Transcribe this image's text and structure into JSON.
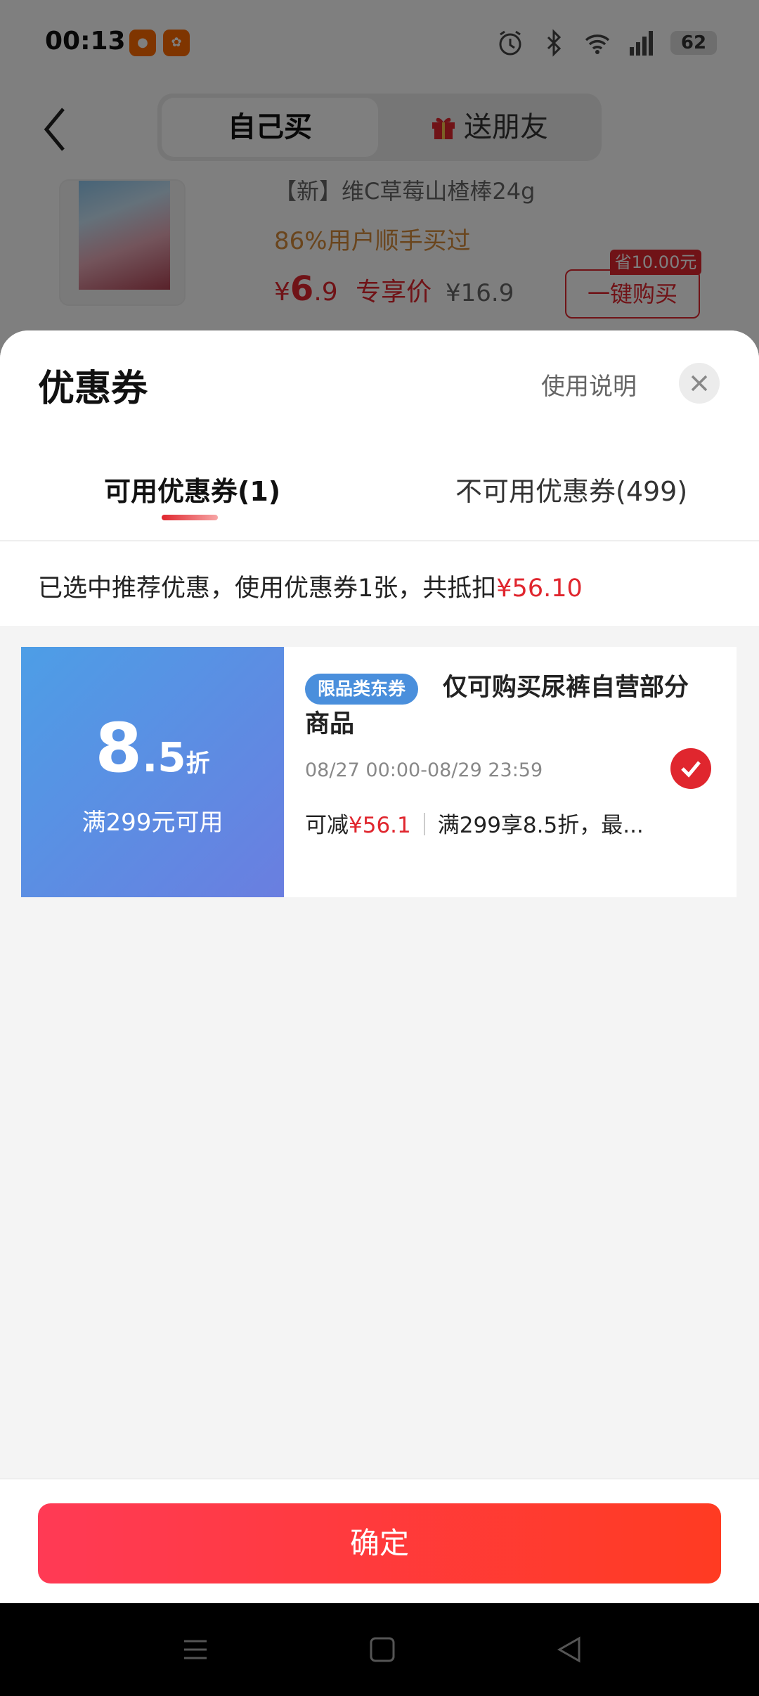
{
  "status_bar": {
    "time": "00:13",
    "battery": "62"
  },
  "nav": {
    "tab_self": "自己买",
    "tab_gift": "送朋友"
  },
  "product": {
    "title": "【新】维C草莓山楂棒24g",
    "subtitle": "86%用户顺手买过",
    "price_symbol": "¥",
    "price_int": "6",
    "price_dec": ".9",
    "price_label": "专享价",
    "original_price": "¥16.9",
    "buy_button": "一键购买",
    "save_tag": "省10.00元"
  },
  "sheet": {
    "title": "优惠券",
    "usage_link": "使用说明",
    "tab_available": "可用优惠券(1)",
    "tab_unavailable": "不可用优惠券(499)",
    "summary_text": "已选中推荐优惠，使用优惠券1张，共抵扣",
    "summary_amount": "¥56.10"
  },
  "coupon": {
    "discount_int": "8",
    "discount_dec": ".5",
    "discount_unit": "折",
    "condition": "满299元可用",
    "tag": "限品类东券",
    "title": "仅可购买尿裤自营部分商品",
    "validity": "08/27 00:00-08/29 23:59",
    "reduce_label": "可减",
    "reduce_amount": "¥56.1",
    "rule": "满299享8.5折，最...",
    "selected": true
  },
  "footer": {
    "confirm": "确定"
  },
  "colors": {
    "accent_red": "#e0262e",
    "coupon_blue": "#4d9ee6",
    "confirm_gradient_start": "#ff3a55",
    "confirm_gradient_end": "#ff3b22"
  },
  "icons": [
    "alarm-icon",
    "bluetooth-icon",
    "wifi-icon",
    "signal-5g-icon",
    "battery-icon",
    "back-arrow-icon",
    "gift-icon",
    "close-icon",
    "checkmark-icon",
    "menu-nav-icon",
    "home-nav-icon",
    "back-nav-icon"
  ]
}
